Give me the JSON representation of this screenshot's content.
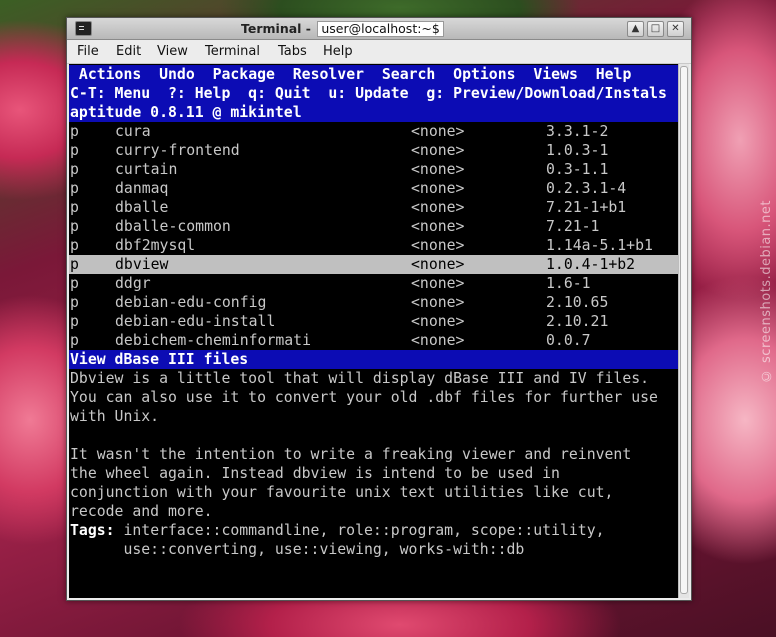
{
  "desktop": {
    "watermark": "© screenshots.debian.net"
  },
  "window": {
    "title_prefix": "Terminal - ",
    "title_user": "user@localhost:~$",
    "buttons": {
      "up": "▲",
      "max": "□",
      "close": "✕"
    },
    "menu": [
      "File",
      "Edit",
      "View",
      "Terminal",
      "Tabs",
      "Help"
    ]
  },
  "aptitude": {
    "menu": [
      "Actions",
      "Undo",
      "Package",
      "Resolver",
      "Search",
      "Options",
      "Views",
      "Help"
    ],
    "shortcuts": "C-T: Menu  ?: Help  q: Quit  u: Update  g: Preview/Download/Instals",
    "header": "aptitude 0.8.11 @ mikintel",
    "packages": [
      {
        "state": "p",
        "name": "cura",
        "installed": "<none>",
        "version": "3.3.1-2"
      },
      {
        "state": "p",
        "name": "curry-frontend",
        "installed": "<none>",
        "version": "1.0.3-1"
      },
      {
        "state": "p",
        "name": "curtain",
        "installed": "<none>",
        "version": "0.3-1.1"
      },
      {
        "state": "p",
        "name": "danmaq",
        "installed": "<none>",
        "version": "0.2.3.1-4"
      },
      {
        "state": "p",
        "name": "dballe",
        "installed": "<none>",
        "version": "7.21-1+b1"
      },
      {
        "state": "p",
        "name": "dballe-common",
        "installed": "<none>",
        "version": "7.21-1"
      },
      {
        "state": "p",
        "name": "dbf2mysql",
        "installed": "<none>",
        "version": "1.14a-5.1+b1"
      },
      {
        "state": "p",
        "name": "dbview",
        "installed": "<none>",
        "version": "1.0.4-1+b2",
        "selected": true
      },
      {
        "state": "p",
        "name": "ddgr",
        "installed": "<none>",
        "version": "1.6-1"
      },
      {
        "state": "p",
        "name": "debian-edu-config",
        "installed": "<none>",
        "version": "2.10.65"
      },
      {
        "state": "p",
        "name": "debian-edu-install",
        "installed": "<none>",
        "version": "2.10.21"
      },
      {
        "state": "p",
        "name": "debichem-cheminformati",
        "installed": "<none>",
        "version": "0.0.7"
      }
    ],
    "summary": "View dBase III files",
    "description": [
      "Dbview is a little tool that will display dBase III and IV files.",
      "You can also use it to convert your old .dbf files for further use",
      "with Unix.",
      "",
      "It wasn't the intention to write a freaking viewer and reinvent",
      "the wheel again. Instead dbview is intend to be used in",
      "conjunction with your favourite unix text utilities like cut,",
      "recode and more."
    ],
    "tags_label": "Tags:",
    "tags": [
      "interface::commandline, role::program, scope::utility,",
      "use::converting, use::viewing, works-with::db"
    ]
  }
}
